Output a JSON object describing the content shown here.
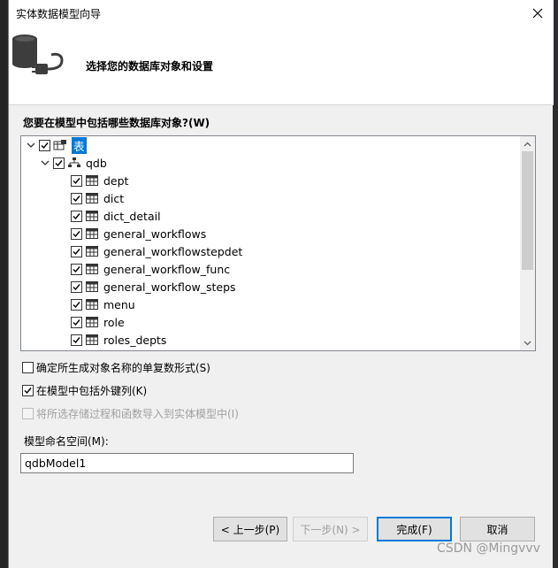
{
  "window": {
    "title": "实体数据模型向导",
    "header_text": "选择您的数据库对象和设置"
  },
  "tree": {
    "label": "您要在模型中包括哪些数据库对象?(W)",
    "root": {
      "label": "表",
      "checked": true,
      "expanded": true
    },
    "database": {
      "label": "qdb",
      "checked": true,
      "expanded": true
    },
    "tables": [
      {
        "label": "dept",
        "checked": true
      },
      {
        "label": "dict",
        "checked": true
      },
      {
        "label": "dict_detail",
        "checked": true
      },
      {
        "label": "general_workflows",
        "checked": true
      },
      {
        "label": "general_workflowstepdet",
        "checked": true
      },
      {
        "label": "general_workflow_func",
        "checked": true
      },
      {
        "label": "general_workflow_steps",
        "checked": true
      },
      {
        "label": "menu",
        "checked": true
      },
      {
        "label": "role",
        "checked": true
      },
      {
        "label": "roles_depts",
        "checked": true
      }
    ]
  },
  "options": {
    "pluralize": {
      "label": "确定所生成对象名称的单复数形式(S)",
      "checked": false,
      "enabled": true
    },
    "foreign_keys": {
      "label": "在模型中包括外键列(K)",
      "checked": true,
      "enabled": true
    },
    "import_procs": {
      "label": "将所选存储过程和函数导入到实体模型中(I)",
      "checked": false,
      "enabled": false
    }
  },
  "namespace": {
    "label": "模型命名空间(M):",
    "value": "qdbModel1"
  },
  "buttons": {
    "back": "< 上一步(P)",
    "next": "下一步(N) >",
    "finish": "完成(F)",
    "cancel": "取消"
  },
  "watermark": "CSDN @Mingvvv",
  "colors": {
    "selection": "#0078d7",
    "dialog_bg": "#f0f0f0",
    "ide_bg": "#1e1e1e"
  }
}
